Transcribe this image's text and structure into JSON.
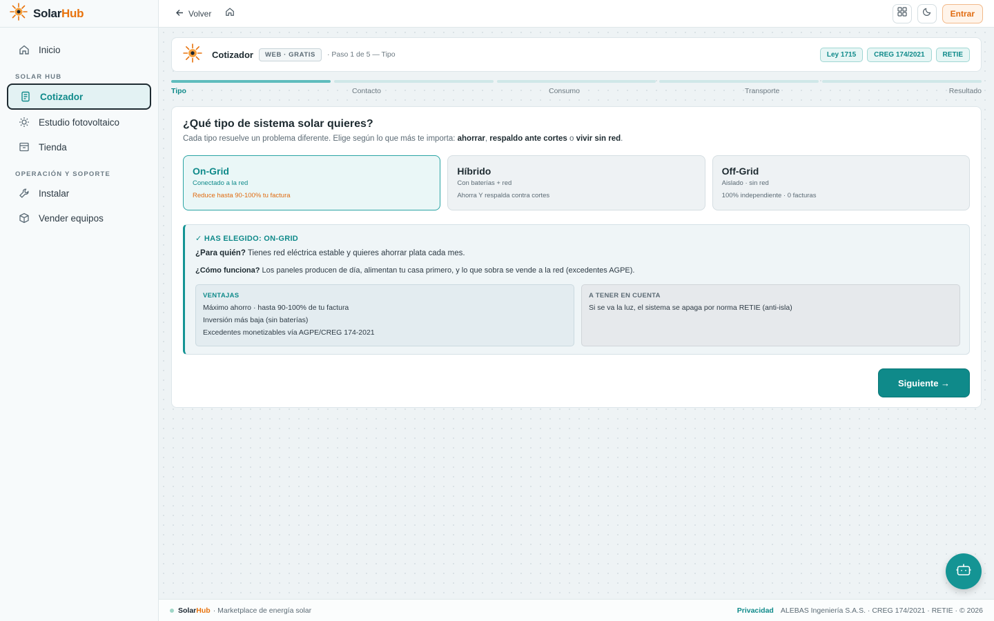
{
  "brand": {
    "part1": "Solar",
    "part2": "Hub"
  },
  "sidebar": {
    "items_top": [
      {
        "label": "Inicio",
        "icon": "home-icon"
      }
    ],
    "section1": "SOLAR HUB",
    "items_solar": [
      {
        "label": "Cotizador",
        "icon": "calculator-icon",
        "active": true
      },
      {
        "label": "Estudio fotovoltaico",
        "icon": "sun-icon"
      },
      {
        "label": "Tienda",
        "icon": "store-icon"
      }
    ],
    "section2": "OPERACIÓN Y SOPORTE",
    "items_ops": [
      {
        "label": "Instalar",
        "icon": "wrench-icon"
      },
      {
        "label": "Vender equipos",
        "icon": "box-icon"
      }
    ]
  },
  "topbar": {
    "back_label": "Volver",
    "login_label": "Entrar"
  },
  "header": {
    "title": "Cotizador",
    "pill": "WEB · GRATIS",
    "step": "· Paso 1 de 5 — Tipo",
    "badges": [
      "Ley 1715",
      "CREG 174/2021",
      "RETIE"
    ]
  },
  "stepper": {
    "steps": [
      "Tipo",
      "Contacto",
      "Consumo",
      "Transporte",
      "Resultado"
    ],
    "current": 1
  },
  "question": {
    "title": "¿Qué tipo de sistema solar quieres?",
    "sub_prefix": "Cada tipo resuelve un problema diferente. Elige según lo que más te importa: ",
    "sub_b1": "ahorrar",
    "sub_sep1": ", ",
    "sub_b2": "respaldo ante cortes",
    "sub_sep2": " o ",
    "sub_b3": "vivir sin red",
    "sub_end": "."
  },
  "options": [
    {
      "name": "On-Grid",
      "desc": "Conectado a la red",
      "note": "Reduce hasta 90-100% tu factura",
      "selected": true
    },
    {
      "name": "Híbrido",
      "desc": "Con baterías + red",
      "note": "Ahorra Y respalda contra cortes"
    },
    {
      "name": "Off-Grid",
      "desc": "Aislado · sin red",
      "note": "100% independiente · 0 facturas"
    }
  ],
  "info": {
    "heading": "✓ HAS ELEGIDO: ON-GRID",
    "who_label": "¿Para quién?",
    "who_text": " Tienes red eléctrica estable y quieres ahorrar plata cada mes.",
    "how_label": "¿Cómo funciona?",
    "how_text": " Los paneles producen de día, alimentan tu casa primero, y lo que sobra se vende a la red (excedentes AGPE).",
    "pros_title": "VENTAJAS",
    "pros": [
      "Máximo ahorro · hasta 90-100% de tu factura",
      "Inversión más baja (sin baterías)",
      "Excedentes monetizables vía AGPE/CREG 174-2021"
    ],
    "cons_title": "A TENER EN CUENTA",
    "cons": [
      "Si se va la luz, el sistema se apaga por norma RETIE (anti-isla)"
    ]
  },
  "actions": {
    "next_label": "Siguiente →"
  },
  "footer": {
    "tagline": "· Marketplace de energía solar",
    "privacy": "Privacidad",
    "legal": "ALEBAS Ingeniería S.A.S. · CREG 174/2021 · RETIE · © 2026"
  },
  "colors": {
    "accent": "#0f8a8a",
    "brand_orange": "#e8720c"
  }
}
